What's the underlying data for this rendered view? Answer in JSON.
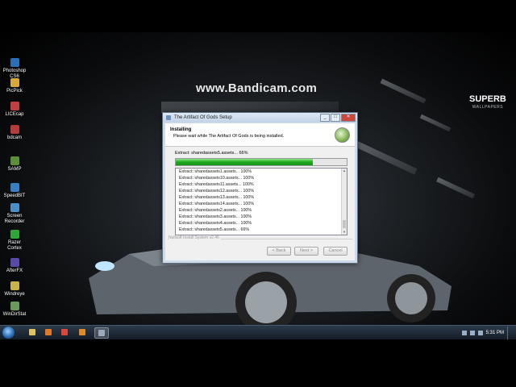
{
  "watermark": "www.Bandicam.com",
  "brand": {
    "line1": "SUPERB",
    "line2": "WALLPAPERS"
  },
  "desktop_icons": [
    {
      "label": "Photoshop CS6",
      "color": "#2a6fb5"
    },
    {
      "label": "PicPick",
      "color": "#d9a93a"
    },
    {
      "label": "LICEcap",
      "color": "#c04040"
    },
    {
      "label": "bdcam",
      "color": "#b23b3b"
    },
    {
      "label": "SAMP",
      "color": "#5b8f3a"
    },
    {
      "label": "SpeedBIT",
      "color": "#3a7fc4"
    },
    {
      "label": "Screen Recorder",
      "color": "#4a90c8"
    },
    {
      "label": "Razer Cortex",
      "color": "#2fa63a"
    },
    {
      "label": "AfterFX",
      "color": "#5a4aa8"
    },
    {
      "label": "Windreye",
      "color": "#c8b24a"
    },
    {
      "label": "WinDirStat",
      "color": "#6a9a5a"
    }
  ],
  "installer": {
    "window_title": "The Artifact Of Gods Setup",
    "heading": "Installing",
    "subheading": "Please wait while The Artifact Of Gods is being installed.",
    "status": "Extract: sharedassets5.assets... 66%",
    "progress": 0.8,
    "log": [
      "Extract: sharedassets1.assets... 100%",
      "Extract: sharedassets10.assets... 100%",
      "Extract: sharedassets11.assets... 100%",
      "Extract: sharedassets12.assets... 100%",
      "Extract: sharedassets13.assets... 100%",
      "Extract: sharedassets14.assets... 100%",
      "Extract: sharedassets2.assets... 100%",
      "Extract: sharedassets3.assets... 100%",
      "Extract: sharedassets4.assets... 100%",
      "Extract: sharedassets5.assets... 66%"
    ],
    "branding": "Nullsoft Install System v2.46",
    "buttons": {
      "back": "< Back",
      "next": "Next >",
      "cancel": "Cancel"
    }
  },
  "taskbar": {
    "items": [
      {
        "icon": "explorer-icon",
        "color": "#e0c060"
      },
      {
        "icon": "media-player-icon",
        "color": "#e07a2a"
      },
      {
        "icon": "chrome-icon",
        "color": "#d9473b"
      },
      {
        "icon": "firefox-icon",
        "color": "#e08a2a"
      },
      {
        "icon": "installer-icon",
        "color": "#9aaabb"
      }
    ],
    "clock": "5:31 PM"
  }
}
